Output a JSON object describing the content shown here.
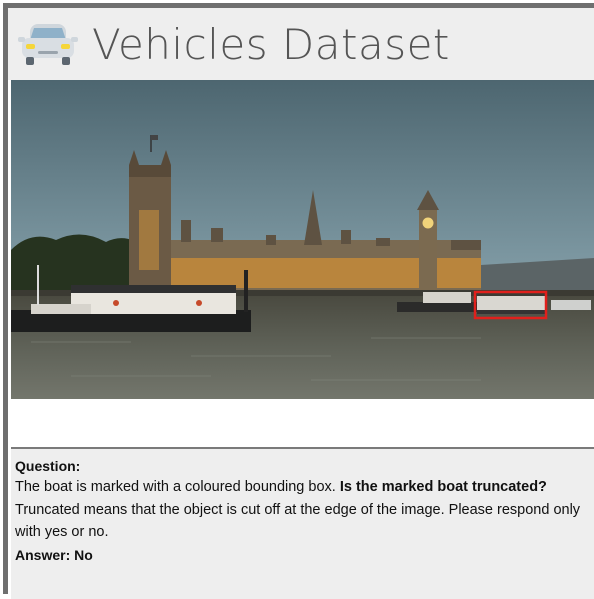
{
  "header": {
    "title": "Vehicles Dataset",
    "icon": "car-icon"
  },
  "photo": {
    "description_icon": "photo-thames-parliament",
    "highlight_color": "#e0201c"
  },
  "question": {
    "label": "Question:",
    "text_part1": "The boat is marked with a coloured bounding box. ",
    "text_bold": "Is the marked boat truncated?",
    "text_part2": " Truncated means that the object is cut off at the edge of the image. Please respond only with yes or no."
  },
  "answer": {
    "label": "Answer: No"
  },
  "colors": {
    "header_bg": "#eeeeee",
    "frame": "#6f6f6f",
    "title": "#555555"
  }
}
